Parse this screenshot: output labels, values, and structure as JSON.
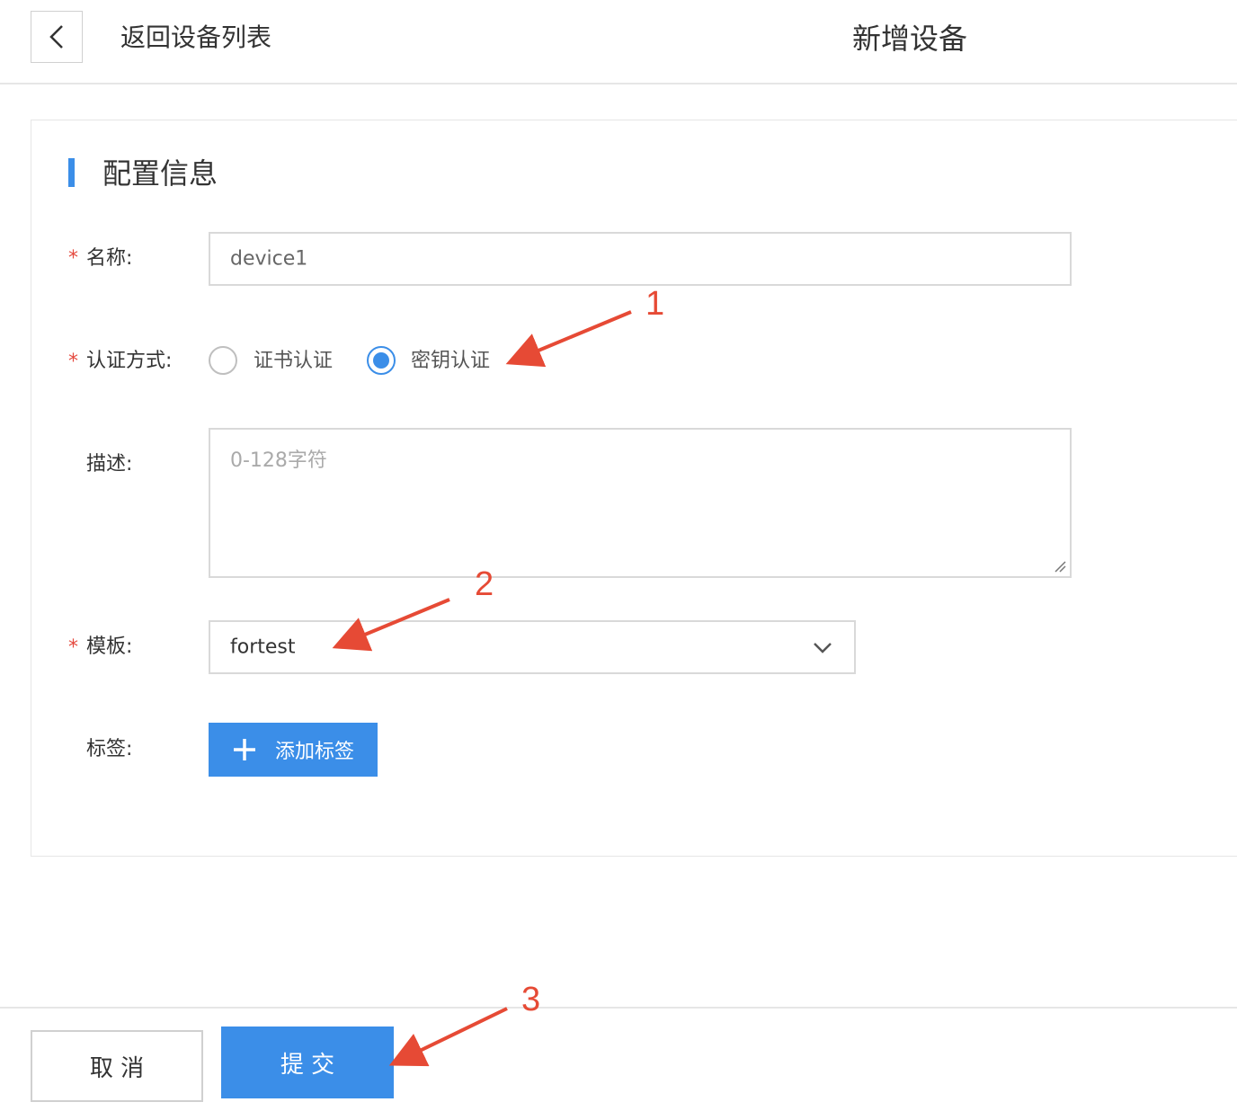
{
  "header": {
    "back_label": "返回设备列表",
    "title": "新增设备"
  },
  "section": {
    "title": "配置信息"
  },
  "form": {
    "required_mark": "*",
    "name": {
      "label": "名称:",
      "value": "device1"
    },
    "auth": {
      "label": "认证方式:",
      "options": [
        {
          "label": "证书认证",
          "selected": false
        },
        {
          "label": "密钥认证",
          "selected": true
        }
      ]
    },
    "description": {
      "label": "描述:",
      "placeholder": "0-128字符"
    },
    "template": {
      "label": "模板:",
      "value": "fortest"
    },
    "tags": {
      "label": "标签:",
      "add_button": "添加标签"
    }
  },
  "footer": {
    "cancel_label": "取 消",
    "submit_label": "提 交"
  },
  "annotations": [
    "1",
    "2",
    "3"
  ],
  "colors": {
    "primary": "#3b8ee8",
    "required": "#e54a3f",
    "annotation": "#e64a35"
  }
}
